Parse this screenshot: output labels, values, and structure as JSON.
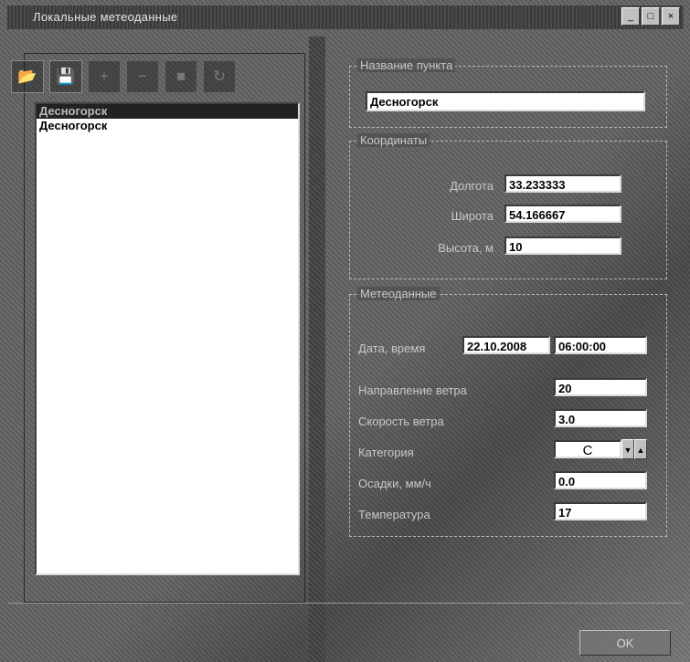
{
  "window": {
    "title": "Локальные метеоданные"
  },
  "window_controls": [
    "_",
    "□",
    "×"
  ],
  "toolbar": {
    "buttons": [
      {
        "icon": "open-folder-icon",
        "glyph": "📂"
      },
      {
        "icon": "save-icon",
        "glyph": "💾"
      },
      {
        "icon": "add-icon",
        "glyph": "+"
      },
      {
        "icon": "remove-icon",
        "glyph": "−"
      },
      {
        "icon": "edit-icon",
        "glyph": "■"
      },
      {
        "icon": "refresh-icon",
        "glyph": "↻"
      }
    ]
  },
  "list": {
    "items": [
      "Десногорск",
      "Десногорск"
    ]
  },
  "point": {
    "legend": "Название пункта",
    "name": "Десногорск"
  },
  "coords": {
    "legend": "Координаты",
    "longitude_label": "Долгота",
    "longitude": "33.233333",
    "latitude_label": "Широта",
    "latitude": "54.166667",
    "altitude_label": "Высота, м",
    "altitude": "10"
  },
  "meteo": {
    "legend": "Метеоданные",
    "datetime_label": "Дата, время",
    "date": "22.10.2008",
    "time": "06:00:00",
    "wind_dir_label": "Направление ветра",
    "wind_dir": "20",
    "wind_speed_label": "Скорость ветра",
    "wind_speed": "3.0",
    "category_label": "Категория",
    "category": "C",
    "precip_label": "Осадки, мм/ч",
    "precip": "0.0",
    "temp_label": "Температура",
    "temp": "17"
  },
  "ok_label": "OK"
}
